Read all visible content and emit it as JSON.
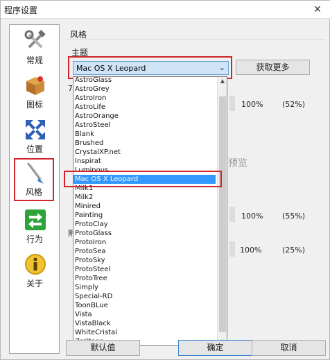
{
  "window": {
    "title": "程序设置",
    "close_glyph": "✕"
  },
  "sidebar": {
    "items": [
      {
        "label": "常规",
        "icon": "tools-icon"
      },
      {
        "label": "图标",
        "icon": "box-icon"
      },
      {
        "label": "位置",
        "icon": "move-arrows-icon"
      },
      {
        "label": "风格",
        "icon": "brush-icon",
        "selected": true
      },
      {
        "label": "行为",
        "icon": "swap-arrows-icon"
      },
      {
        "label": "关于",
        "icon": "info-icon"
      }
    ]
  },
  "style": {
    "group_title": "风格",
    "theme_label": "主题",
    "theme_value": "Mac OS X Leopard",
    "more_button": "获取更多"
  },
  "background": {
    "row1": {
      "value": "100%",
      "extra": "(52%)"
    },
    "row2": {
      "value": "100%",
      "extra": "(55%)"
    },
    "row3": {
      "value": "100%",
      "extra": "(25%)"
    },
    "faint_text": "预览",
    "partial_1": "7",
    "partial_2": "附"
  },
  "dropdown": {
    "items": [
      "AstroGlass",
      "AstroGrey",
      "AstroIron",
      "AstroLife",
      "AstroOrange",
      "AstroSteel",
      "Blank",
      "Brushed",
      "CrystalXP.net",
      "Inspirat",
      "Luminous",
      "Mac OS X Leopard",
      "Milk1",
      "Milk2",
      "Minired",
      "Painting",
      "ProtoClay",
      "ProtoGlass",
      "ProtoIron",
      "ProtoSea",
      "ProtoSky",
      "ProtoSteel",
      "ProtoTree",
      "Simply",
      "Special-RD",
      "ToonBLue",
      "Vista",
      "VistaBlack",
      "WhiteCristal",
      "ZaKtoon"
    ],
    "selected": "Mac OS X Leopard"
  },
  "footer": {
    "default_button": "默认值",
    "ok_button": "确定",
    "cancel_button": "取消"
  },
  "colors": {
    "accent_red": "#d0262b",
    "selection_blue": "#3399ff",
    "combo_fill": "#cfe4f7"
  }
}
